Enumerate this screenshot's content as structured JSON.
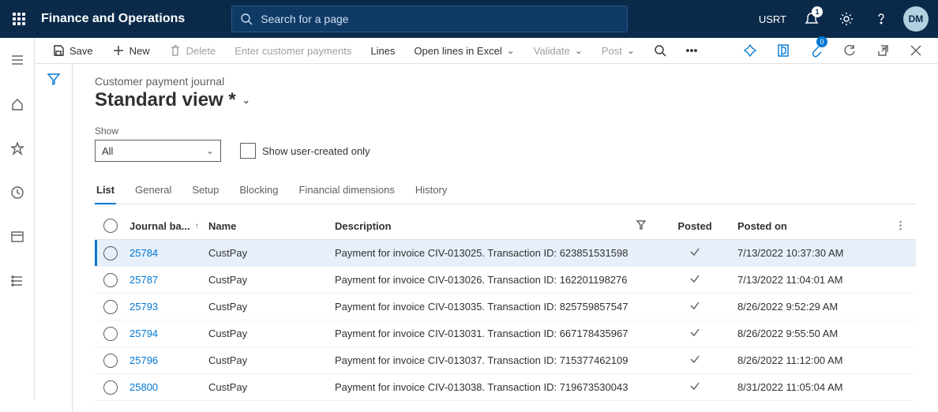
{
  "topbar": {
    "app_title": "Finance and Operations",
    "search_placeholder": "Search for a page",
    "company": "USRT",
    "notification_count": "1",
    "user_initials": "DM"
  },
  "toolbar": {
    "save": "Save",
    "new": "New",
    "delete": "Delete",
    "enter_payments": "Enter customer payments",
    "lines": "Lines",
    "open_excel": "Open lines in Excel",
    "validate": "Validate",
    "post": "Post",
    "attach_count": "0"
  },
  "page": {
    "breadcrumb": "Customer payment journal",
    "view_title": "Standard view *"
  },
  "filters": {
    "show_label": "Show",
    "show_value": "All",
    "user_created_label": "Show user-created only"
  },
  "tabs": [
    {
      "id": "list",
      "label": "List",
      "active": true
    },
    {
      "id": "general",
      "label": "General",
      "active": false
    },
    {
      "id": "setup",
      "label": "Setup",
      "active": false
    },
    {
      "id": "blocking",
      "label": "Blocking",
      "active": false
    },
    {
      "id": "findim",
      "label": "Financial dimensions",
      "active": false
    },
    {
      "id": "history",
      "label": "History",
      "active": false
    }
  ],
  "columns": {
    "journal": "Journal ba...",
    "name": "Name",
    "description": "Description",
    "posted": "Posted",
    "posted_on": "Posted on"
  },
  "rows": [
    {
      "journal": "25784",
      "name": "CustPay",
      "description": "Payment for invoice CIV-013025. Transaction ID: 623851531598",
      "posted": true,
      "posted_on": "7/13/2022 10:37:30 AM",
      "selected": true
    },
    {
      "journal": "25787",
      "name": "CustPay",
      "description": "Payment for invoice CIV-013026. Transaction ID: 162201198276",
      "posted": true,
      "posted_on": "7/13/2022 11:04:01 AM",
      "selected": false
    },
    {
      "journal": "25793",
      "name": "CustPay",
      "description": "Payment for invoice CIV-013035. Transaction ID: 825759857547",
      "posted": true,
      "posted_on": "8/26/2022 9:52:29 AM",
      "selected": false
    },
    {
      "journal": "25794",
      "name": "CustPay",
      "description": "Payment for invoice CIV-013031. Transaction ID: 667178435967",
      "posted": true,
      "posted_on": "8/26/2022 9:55:50 AM",
      "selected": false
    },
    {
      "journal": "25796",
      "name": "CustPay",
      "description": "Payment for invoice CIV-013037. Transaction ID: 715377462109",
      "posted": true,
      "posted_on": "8/26/2022 11:12:00 AM",
      "selected": false
    },
    {
      "journal": "25800",
      "name": "CustPay",
      "description": "Payment for invoice CIV-013038. Transaction ID: 719673530043",
      "posted": true,
      "posted_on": "8/31/2022 11:05:04 AM",
      "selected": false
    }
  ]
}
